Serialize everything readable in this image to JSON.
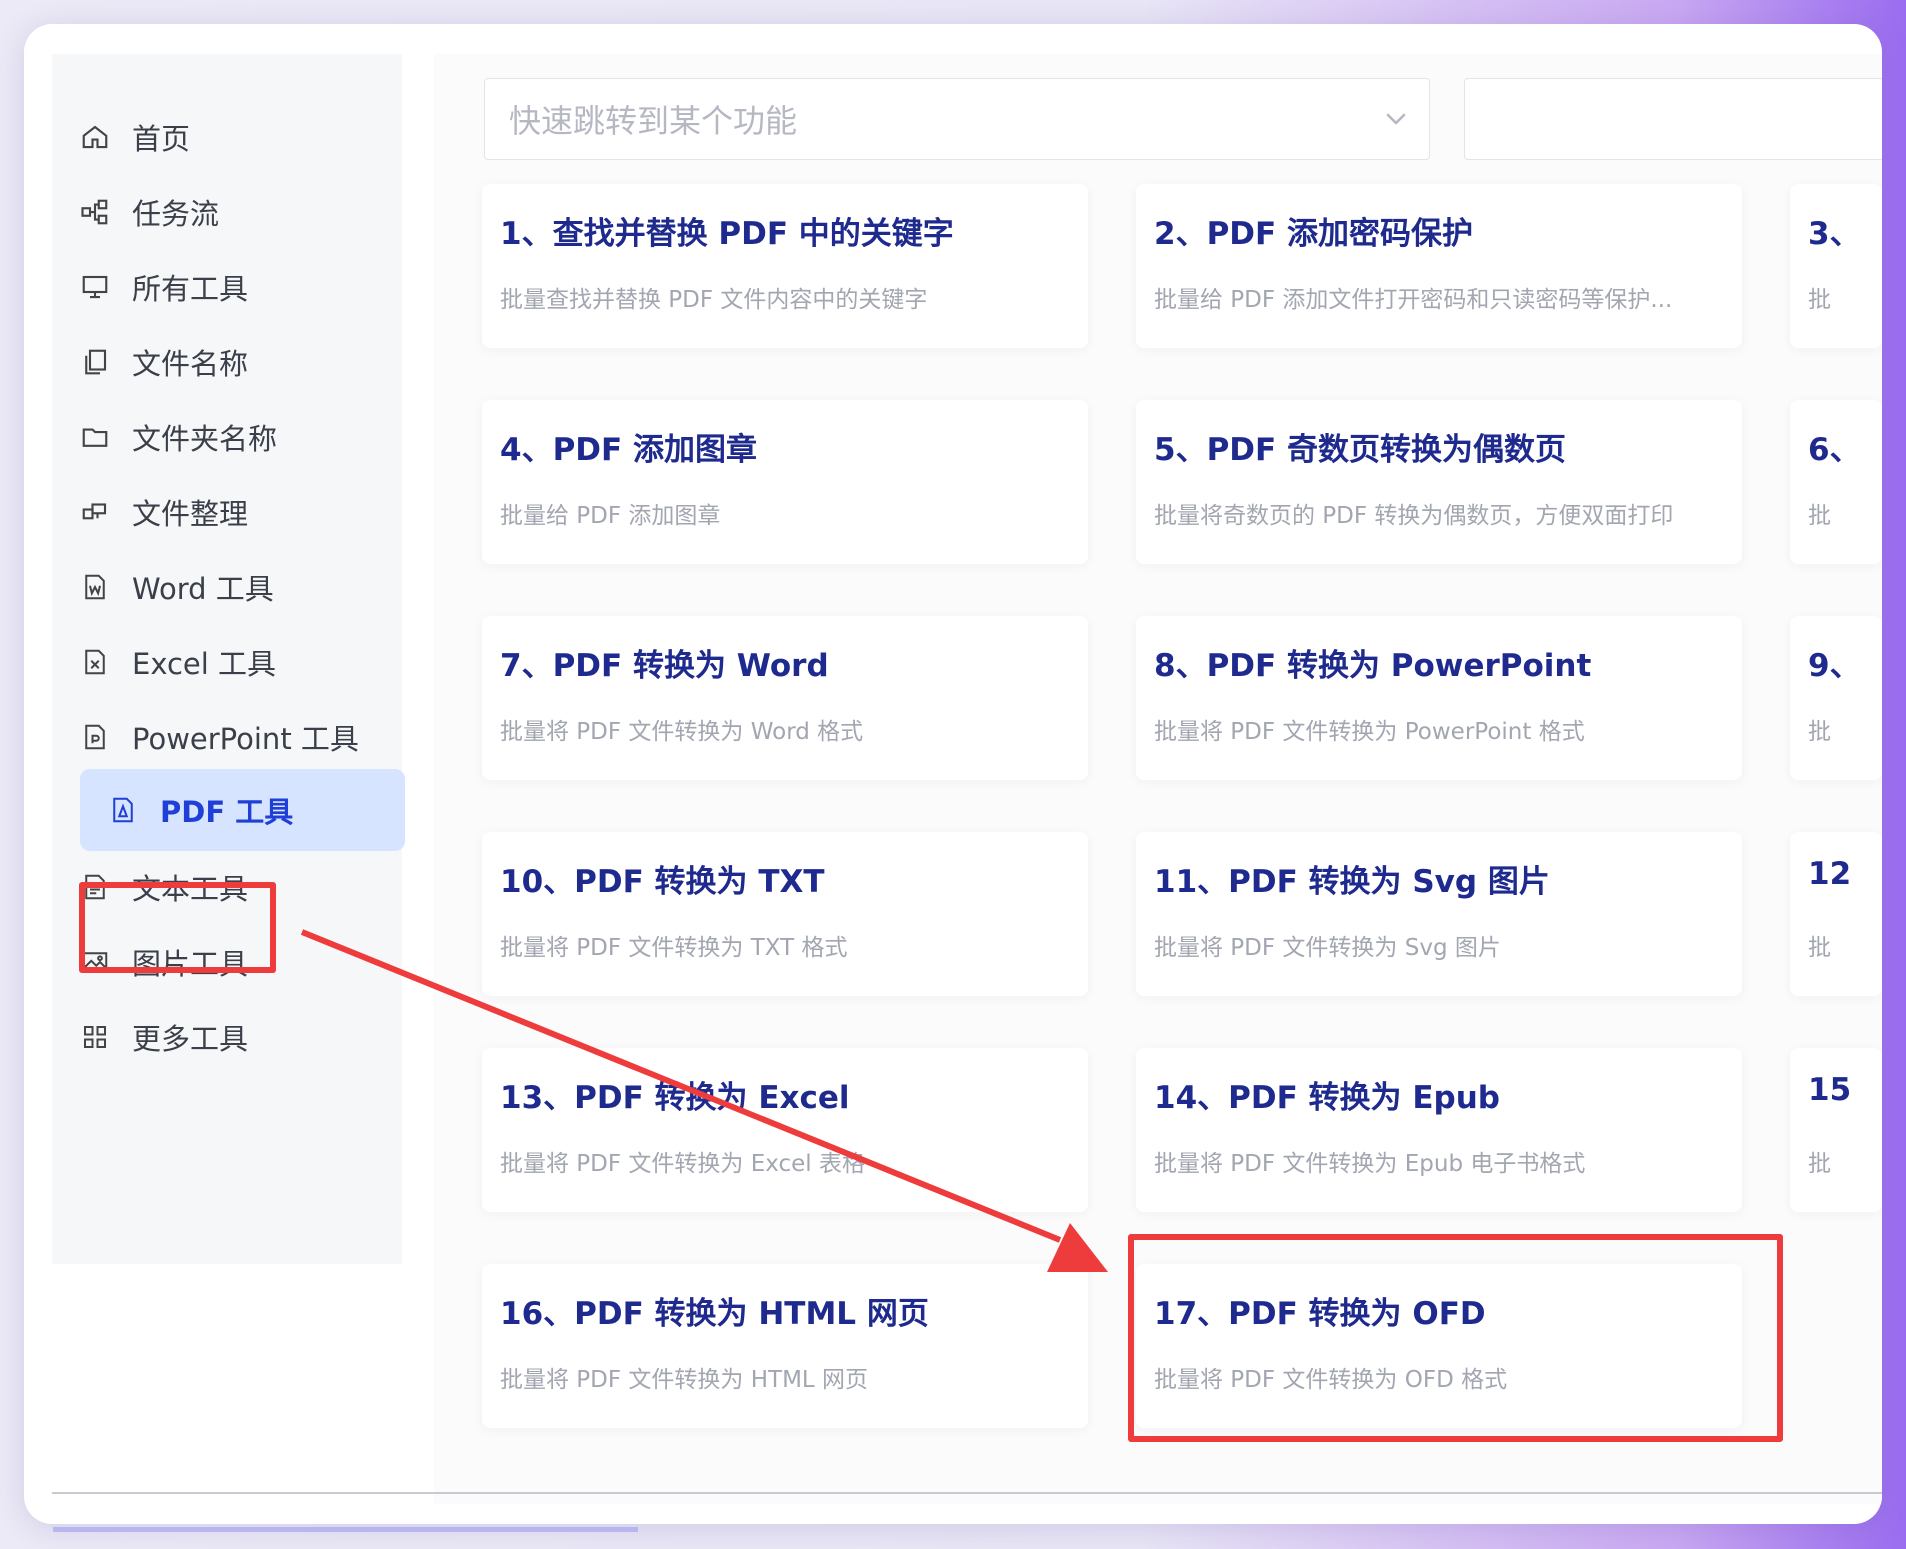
{
  "sidebar": {
    "items": [
      {
        "label": "首页",
        "icon": "home-icon"
      },
      {
        "label": "任务流",
        "icon": "workflow-icon"
      },
      {
        "label": "所有工具",
        "icon": "monitor-icon"
      },
      {
        "label": "文件名称",
        "icon": "file-copy-icon"
      },
      {
        "label": "文件夹名称",
        "icon": "folder-icon"
      },
      {
        "label": "文件整理",
        "icon": "organize-icon"
      },
      {
        "label": "Word 工具",
        "icon": "word-file-icon"
      },
      {
        "label": "Excel 工具",
        "icon": "excel-file-icon"
      },
      {
        "label": "PowerPoint 工具",
        "icon": "powerpoint-file-icon"
      },
      {
        "label": "PDF 工具",
        "icon": "pdf-file-icon",
        "active": true
      },
      {
        "label": "文本工具",
        "icon": "text-file-icon"
      },
      {
        "label": "图片工具",
        "icon": "image-icon"
      },
      {
        "label": "更多工具",
        "icon": "grid-icon"
      }
    ]
  },
  "search": {
    "placeholder": "快速跳转到某个功能",
    "icon": "chevron-down-icon"
  },
  "cards": [
    {
      "title": "1、查找并替换 PDF 中的关键字",
      "desc": "批量查找并替换 PDF 文件内容中的关键字"
    },
    {
      "title": "2、PDF 添加密码保护",
      "desc": "批量给 PDF 添加文件打开密码和只读密码等保护..."
    },
    {
      "title": "3、",
      "desc": "批"
    },
    {
      "title": "4、PDF 添加图章",
      "desc": "批量给 PDF 添加图章"
    },
    {
      "title": "5、PDF 奇数页转换为偶数页",
      "desc": "批量将奇数页的 PDF 转换为偶数页，方便双面打印"
    },
    {
      "title": "6、",
      "desc": "批"
    },
    {
      "title": "7、PDF 转换为 Word",
      "desc": "批量将 PDF 文件转换为 Word 格式"
    },
    {
      "title": "8、PDF 转换为 PowerPoint",
      "desc": "批量将 PDF 文件转换为 PowerPoint 格式"
    },
    {
      "title": "9、",
      "desc": "批"
    },
    {
      "title": "10、PDF 转换为 TXT",
      "desc": "批量将 PDF 文件转换为 TXT 格式"
    },
    {
      "title": "11、PDF 转换为 Svg 图片",
      "desc": "批量将 PDF 文件转换为 Svg 图片"
    },
    {
      "title": "12",
      "desc": "批"
    },
    {
      "title": "13、PDF 转换为 Excel",
      "desc": "批量将 PDF 文件转换为 Excel 表格"
    },
    {
      "title": "14、PDF 转换为 Epub",
      "desc": "批量将 PDF 文件转换为 Epub 电子书格式"
    },
    {
      "title": "15",
      "desc": "批"
    },
    {
      "title": "16、PDF 转换为 HTML 网页",
      "desc": "批量将 PDF 文件转换为 HTML 网页"
    },
    {
      "title": "17、PDF 转换为 OFD",
      "desc": "批量将 PDF 文件转换为 OFD 格式"
    }
  ],
  "colors": {
    "accent": "#1f3fd6",
    "title": "#1e2a8e",
    "highlight": "#ee3b3b",
    "active_bg": "#d6e4ff"
  }
}
